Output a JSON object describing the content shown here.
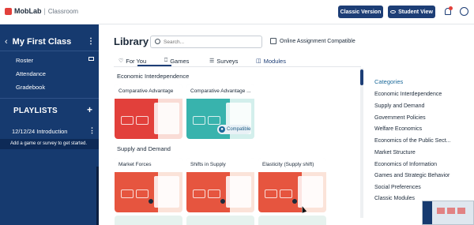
{
  "app": {
    "brand": "MobLab",
    "sub": "Classroom",
    "classic_version": "Classic Version",
    "student_view": "Student View"
  },
  "sidebar": {
    "class_title": "My First Class",
    "links": [
      "Roster",
      "Attendance",
      "Gradebook"
    ],
    "playlists_label": "PLAYLISTS",
    "playlist_item": "12/12/24 Introduction",
    "hint": "Add a game or survey to get started."
  },
  "library": {
    "title": "Library",
    "search_placeholder": "Search...",
    "online_assignment": "Online Assignment Compatible",
    "tabs": [
      {
        "label": "For You",
        "icon": "heart-icon"
      },
      {
        "label": "Games",
        "icon": "gamepad-icon"
      },
      {
        "label": "Surveys",
        "icon": "list-icon"
      },
      {
        "label": "Modules",
        "icon": "module-icon",
        "active": true
      }
    ],
    "sections": [
      {
        "label": "Economic Interdependence",
        "cards": [
          {
            "title": "Comparative Advantage",
            "color": "#e2403b",
            "compatible": false
          },
          {
            "title": "Comparative Advantage ...",
            "color": "#38b3ad",
            "compatible": true
          }
        ]
      },
      {
        "label": "Supply and Demand",
        "cards": [
          {
            "title": "Market Forces",
            "color": "#e6553f"
          },
          {
            "title": "Shifts in Supply",
            "color": "#e6553f"
          },
          {
            "title": "Elasticity (Supply shift)",
            "color": "#e6553f"
          }
        ]
      }
    ],
    "compatible_badge": "Compatible"
  },
  "categories": {
    "title": "Categories",
    "items": [
      "Economic Interdependence",
      "Supply and Demand",
      "Government Policies",
      "Welfare Economics",
      "Economics of the Public Sect...",
      "Market Structure",
      "Economics of Information",
      "Games and Strategic Behavior",
      "Social Preferences",
      "Classic Modules"
    ]
  },
  "colors": {
    "navy": "#163a6f",
    "accent": "#1d3e76",
    "red": "#e2403b",
    "teal": "#38b3ad"
  }
}
